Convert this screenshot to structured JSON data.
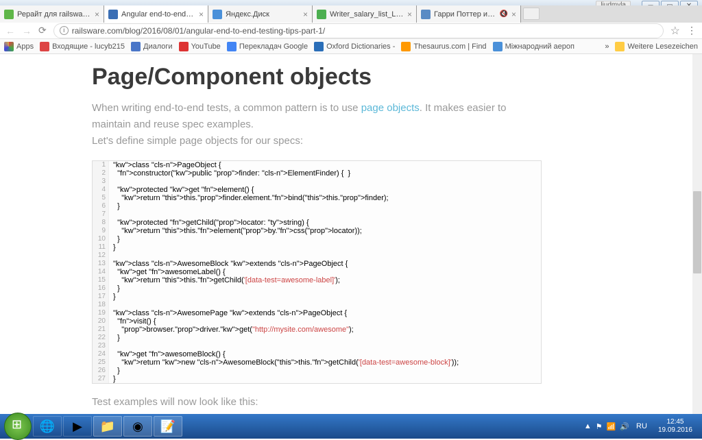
{
  "window": {
    "user": "liudmyla"
  },
  "tabs": [
    {
      "title": "Рерайт для railsware.com",
      "color": "#5fb648"
    },
    {
      "title": "Angular end-to-end test",
      "color": "#3b6fb5",
      "active": true
    },
    {
      "title": "Яндекс.Диск",
      "color": "#4a90d9"
    },
    {
      "title": "Writer_salary_list_L.BUTE",
      "color": "#4caf50"
    },
    {
      "title": "Гарри Поттер и орде",
      "color": "#5a8bc4",
      "audio": true
    }
  ],
  "url": "railsware.com/blog/2016/08/01/angular-end-to-end-testing-tips-part-1/",
  "bookmarks": {
    "apps": "Apps",
    "items": [
      {
        "label": "Входящие - lucyb215",
        "color": "#d44"
      },
      {
        "label": "Диалоги",
        "color": "#4a76c8"
      },
      {
        "label": "YouTube",
        "color": "#d33"
      },
      {
        "label": "Перекладач Google",
        "color": "#4285f4"
      },
      {
        "label": "Oxford Dictionaries -",
        "color": "#2a6eb8"
      },
      {
        "label": "Thesaurus.com | Find",
        "color": "#f90"
      },
      {
        "label": "Міжнародний аероп",
        "color": "#4a90d9"
      }
    ],
    "more": "»",
    "other": "Weitere Lesezeichen"
  },
  "article": {
    "heading": "Page/Component objects",
    "para_before": "When writing end-to-end tests, a common pattern is to use ",
    "para_link": "page objects",
    "para_after": ". It makes easier to maintain and reuse spec examples.",
    "para_line2": "Let's define simple page objects for our specs:",
    "outro": "Test examples will now look like this:"
  },
  "code": [
    "class PageObject {",
    "  constructor(public finder: ElementFinder) {  }",
    "",
    "  protected get element() {",
    "    return this.finder.element.bind(this.finder);",
    "  }",
    "",
    "  protected getChild(locator: string) {",
    "    return this.element(by.css(locator));",
    "  }",
    "}",
    "",
    "class AwesomeBlock extends PageObject {",
    "  get awesomeLabel() {",
    "    return this.getChild('[data-test=awesome-label]');",
    "  }",
    "}",
    "",
    "class AwesomePage extends PageObject {",
    "  visit() {",
    "    browser.driver.get(\"http://mysite.com/awesome\");",
    "  }",
    "",
    "  get awesomeBlock() {",
    "    return new AwesomeBlock(this.getChild('[data-test=awesome-block]'));",
    "  }",
    "}"
  ],
  "taskbar": {
    "tray_lang": "RU",
    "time": "12:45",
    "date": "19.09.2016"
  }
}
